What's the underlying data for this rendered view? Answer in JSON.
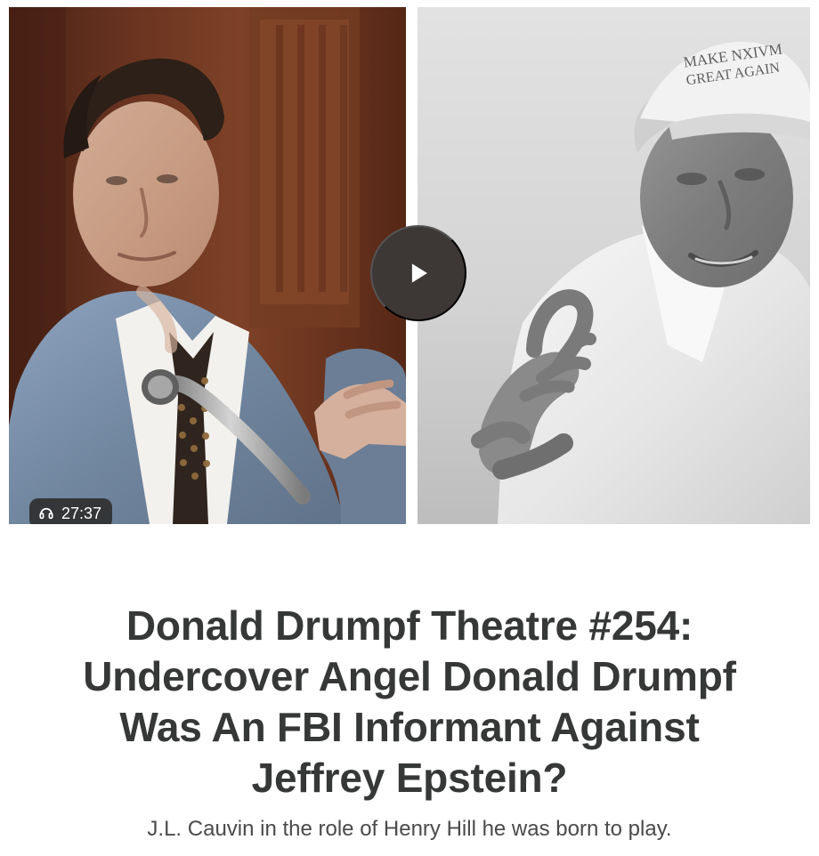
{
  "media": {
    "play_icon": "play-icon",
    "audio_icon": "headphones-icon",
    "duration": "27:37",
    "cap_text": "MAKE NXIVM GREAT AGAIN"
  },
  "article": {
    "title": "Donald Drumpf Theatre #254: Undercover Angel Donald Drumpf Was An FBI Informant Against Jeffrey Epstein?",
    "subtitle": "J.L. Cauvin in the role of Henry Hill he was born to play."
  },
  "colors": {
    "text": "#363737",
    "subtitle": "#4a4a4a",
    "play_button": "#3d3735",
    "badge_bg": "#2e2e2e",
    "background": "#ffffff"
  }
}
